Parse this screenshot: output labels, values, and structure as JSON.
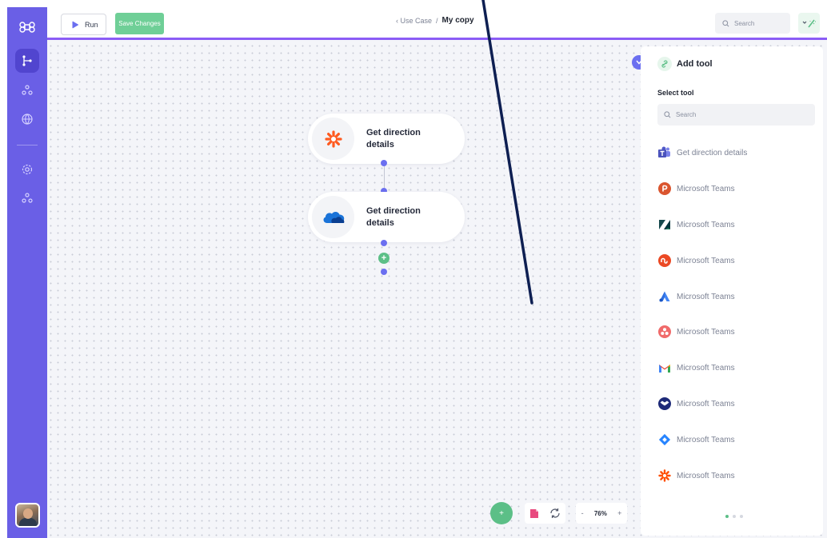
{
  "sidebar": {
    "logo_icon": "command-icon",
    "items": [
      {
        "icon": "flow-icon",
        "active": true
      },
      {
        "icon": "team-icon",
        "active": false
      },
      {
        "icon": "globe-icon",
        "active": false
      },
      {
        "icon": "settings-icon",
        "active": false
      },
      {
        "icon": "users-icon",
        "active": false
      }
    ]
  },
  "toolbar": {
    "run_label": "Run",
    "save_label": "Save Changes",
    "crumb_back": "‹ Use Case",
    "crumb_sep": "/",
    "crumb_current": "My copy",
    "search_placeholder": "Search"
  },
  "nodes": [
    {
      "label": "Get direction details",
      "icon": "asterisk-orange-icon"
    },
    {
      "label": "Get direction details",
      "icon": "cloud-blue-icon"
    }
  ],
  "panel": {
    "title": "Add tool",
    "select_label": "Select tool",
    "search_placeholder": "Search",
    "tools": [
      {
        "label": "Get direction details",
        "icon": "teams-icon"
      },
      {
        "label": "Microsoft Teams",
        "icon": "producthunt-icon"
      },
      {
        "label": "Microsoft Teams",
        "icon": "zendesk-icon"
      },
      {
        "label": "Microsoft Teams",
        "icon": "stumbleupon-icon"
      },
      {
        "label": "Microsoft Teams",
        "icon": "google-ads-icon"
      },
      {
        "label": "Microsoft Teams",
        "icon": "asana-icon"
      },
      {
        "label": "Microsoft Teams",
        "icon": "gmail-icon"
      },
      {
        "label": "Microsoft Teams",
        "icon": "dropbox-icon"
      },
      {
        "label": "Microsoft Teams",
        "icon": "jira-icon"
      },
      {
        "label": "Microsoft Teams",
        "icon": "zapier-icon"
      }
    ]
  },
  "zoom": {
    "minus": "-",
    "value": "76%",
    "plus": "+"
  },
  "colors": {
    "sidebar": "#6a5fe6",
    "accent_green": "#5cbf87",
    "accent_purple": "#8b5cf6",
    "node_dot": "#6b6ff0"
  }
}
